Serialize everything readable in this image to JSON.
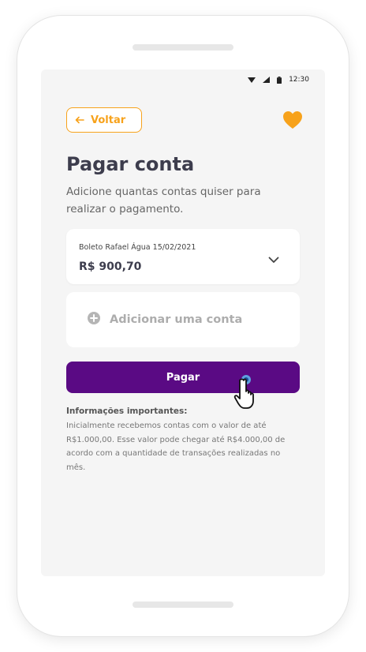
{
  "status_bar": {
    "time": "12:30"
  },
  "header": {
    "back_label": "Voltar",
    "title": "Pagar conta",
    "subtitle": "Adicione quantas contas quiser para realizar o pagamento."
  },
  "bill": {
    "description": "Boleto Rafael Água 15/02/2021",
    "amount": "R$ 900,70"
  },
  "add_bill": {
    "label": "Adicionar uma conta"
  },
  "pay_button": {
    "label": "Pagar"
  },
  "info": {
    "title": "Informações importantes:",
    "text": "Inicialmente recebemos contas com o valor de até R$1.000,00. Esse valor pode chegar até R$4.000,00 de acordo com a quantidade de transações realizadas no mês."
  },
  "colors": {
    "accent_orange": "#f7a21b",
    "primary_purple": "#5a0a84",
    "title_text": "#3d3d4d",
    "screen_bg": "#f5f5f5"
  },
  "icons": [
    "wifi-icon",
    "signal-icon",
    "battery-icon",
    "arrow-left-icon",
    "heart-icon",
    "chevron-down-icon",
    "add-circle-icon",
    "hand-cursor-icon"
  ]
}
